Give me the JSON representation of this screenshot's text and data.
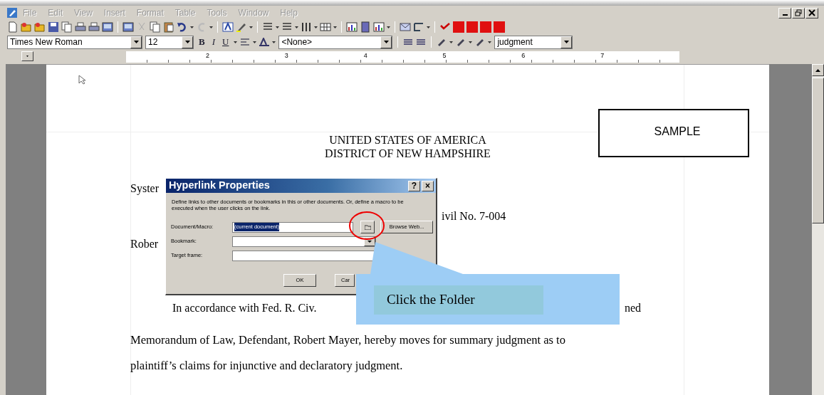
{
  "menu": [
    {
      "label": "File",
      "disabled": true
    },
    {
      "label": "Edit",
      "disabled": true
    },
    {
      "label": "View",
      "disabled": true
    },
    {
      "label": "Insert",
      "disabled": true
    },
    {
      "label": "Format",
      "disabled": true
    },
    {
      "label": "Table",
      "disabled": true
    },
    {
      "label": "Tools",
      "disabled": true
    },
    {
      "label": "Window",
      "disabled": true
    },
    {
      "label": "Help",
      "disabled": true
    }
  ],
  "format_bar": {
    "font": "Times New Roman",
    "size": "12",
    "style_buttons": [
      "B",
      "I",
      "U"
    ],
    "style": "<None>",
    "find": "judgment"
  },
  "ruler": {
    "labels": [
      "2",
      "3",
      "4",
      "5",
      "6",
      "7"
    ]
  },
  "document": {
    "heading": [
      "UNITED STATES OF AMERICA",
      "DISTRICT OF NEW HAMPSHIRE"
    ],
    "party_1": "Syster",
    "case_number": "ivil No. 7-004",
    "party_2": "Rober",
    "paragraph_start": "In accordance with Fed. R. Civ.",
    "paragraph_end": "ned",
    "lines": [
      "Memorandum of Law, Defendant, Robert Mayer, hereby moves for summary judgment as to",
      "plaintiff’s claims for injunctive and declaratory judgment."
    ]
  },
  "stamp": "SAMPLE",
  "dialog": {
    "title": "Hyperlink Properties",
    "help": "?",
    "close": "×",
    "description": "Define links to other documents or bookmarks in this or other documents. Or, define a macro to be executed when the user clicks on the link.",
    "fields": [
      {
        "label": "Document/Macro:",
        "kind": "text",
        "value": "(current document)",
        "selected": true
      },
      {
        "label": "Bookmark:",
        "kind": "combo"
      },
      {
        "label": "Target frame:",
        "kind": "text"
      }
    ],
    "browse_button": "Browse Web...",
    "buttons": [
      "OK",
      "Car"
    ]
  },
  "callout": {
    "text": "Click the Folder"
  }
}
